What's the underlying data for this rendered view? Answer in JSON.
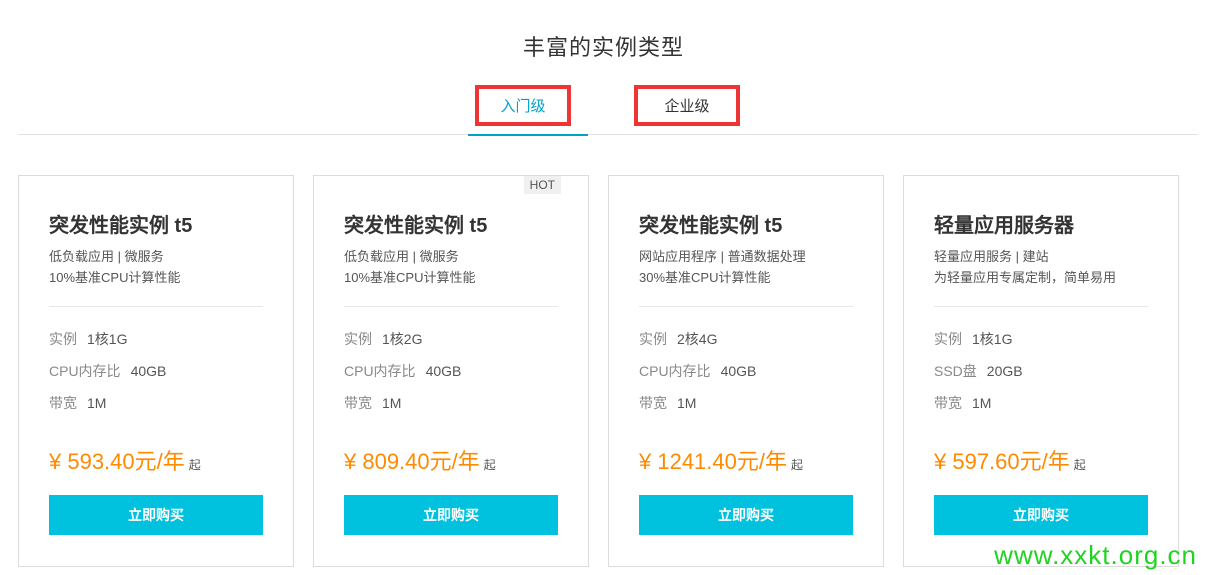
{
  "page": {
    "title": "丰富的实例类型",
    "tabs": [
      {
        "label": "入门级",
        "active": true
      },
      {
        "label": "企业级",
        "active": false
      }
    ]
  },
  "cards": [
    {
      "name": "突发性能实例 t5",
      "desc1": "低负载应用 | 微服务",
      "desc2": "10%基准CPU计算性能",
      "badge": "",
      "specs": [
        {
          "label": "实例",
          "value": "1核1G"
        },
        {
          "label": "CPU内存比",
          "value": "40GB"
        },
        {
          "label": "带宽",
          "value": "1M"
        }
      ],
      "price": "¥ 593.40元/年",
      "price_suffix": "起",
      "button": "立即购买"
    },
    {
      "name": "突发性能实例 t5",
      "desc1": "低负载应用 | 微服务",
      "desc2": "10%基准CPU计算性能",
      "badge": "HOT",
      "specs": [
        {
          "label": "实例",
          "value": "1核2G"
        },
        {
          "label": "CPU内存比",
          "value": "40GB"
        },
        {
          "label": "带宽",
          "value": "1M"
        }
      ],
      "price": "¥ 809.40元/年",
      "price_suffix": "起",
      "button": "立即购买"
    },
    {
      "name": "突发性能实例 t5",
      "desc1": "网站应用程序 | 普通数据处理",
      "desc2": "30%基准CPU计算性能",
      "badge": "",
      "specs": [
        {
          "label": "实例",
          "value": "2核4G"
        },
        {
          "label": "CPU内存比",
          "value": "40GB"
        },
        {
          "label": "带宽",
          "value": "1M"
        }
      ],
      "price": "¥ 1241.40元/年",
      "price_suffix": "起",
      "button": "立即购买"
    },
    {
      "name": "轻量应用服务器",
      "desc1": "轻量应用服务 | 建站",
      "desc2": "为轻量应用专属定制，简单易用",
      "badge": "",
      "specs": [
        {
          "label": "实例",
          "value": "1核1G"
        },
        {
          "label": "SSD盘",
          "value": "20GB"
        },
        {
          "label": "带宽",
          "value": "1M"
        }
      ],
      "price": "¥ 597.60元/年",
      "price_suffix": "起",
      "button": "立即购买"
    }
  ],
  "watermark": "www.xxkt.org.cn",
  "colors": {
    "accent": "#00a2ca",
    "button": "#00c1de",
    "price": "#ff8a00",
    "highlight_box": "#ee3535",
    "watermark": "#21d321"
  }
}
